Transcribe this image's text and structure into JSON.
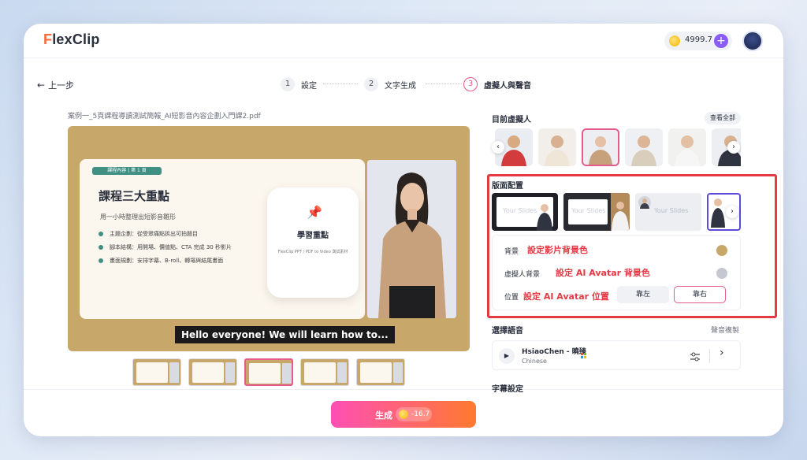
{
  "app": {
    "logo_f": "F",
    "logo_rest": "lexClip"
  },
  "header": {
    "credits": "4999.7",
    "plus_label": "+"
  },
  "nav": {
    "back_label": "上一步",
    "back_arrow": "←"
  },
  "steps": [
    {
      "num": "1",
      "label": "設定"
    },
    {
      "num": "2",
      "label": "文字生成"
    },
    {
      "num": "3",
      "label": "虛擬人與聲音"
    }
  ],
  "file": {
    "name": "案例一_5頁課程導讀測試簡報_AI短影音內容企劃入門課2.pdf"
  },
  "slide": {
    "tag": "課程內容 | 第 1 頁",
    "title": "課程三大重點",
    "subtitle": "用一小時整理出短影音雛形",
    "bullets": [
      "主題企劃：從受眾痛點拆出可拍題目",
      "腳本結構：用開場、價值點、CTA 完成 30 秒影片",
      "畫面規劃：安排字幕、B-roll、轉場與結尾畫面"
    ],
    "card_icon": "📌",
    "card_title": "學習重點",
    "card_note": "FlexClip PPT / PDF to Video 測試素材",
    "caption": "Hello everyone! We will learn how to..."
  },
  "footer": {
    "generate_label": "生成",
    "cost": "-16.7"
  },
  "panel": {
    "current_avatar_title": "目前虛擬人",
    "view_all": "查看全部",
    "layout_title": "版面配置",
    "layout_placeholder": "Your Slides",
    "background_label": "背景",
    "background_note": "設定影片背景色",
    "avatar_bg_label": "虛擬人背景",
    "avatar_bg_note": "設定 AI Avatar 背景色",
    "position_label": "位置",
    "position_note": "設定 AI Avatar 位置",
    "pos_left": "靠左",
    "pos_right": "靠右",
    "voice_title": "選擇語音",
    "voice_clone": "聲音複製",
    "voice_name": "HsiaoChen - 曉臻",
    "voice_lang": "Chinese",
    "subtitle_title": "字幕設定",
    "arrow_left": "‹",
    "arrow_right": "›",
    "play_icon": "▶",
    "chevron": "›"
  },
  "colors": {
    "accent": "#e65a8c",
    "highlight": "#e53945",
    "slide_bg": "#c8a86a",
    "swatch_bg": "#c8a86a",
    "swatch_avatar": "#c5c8d1"
  }
}
